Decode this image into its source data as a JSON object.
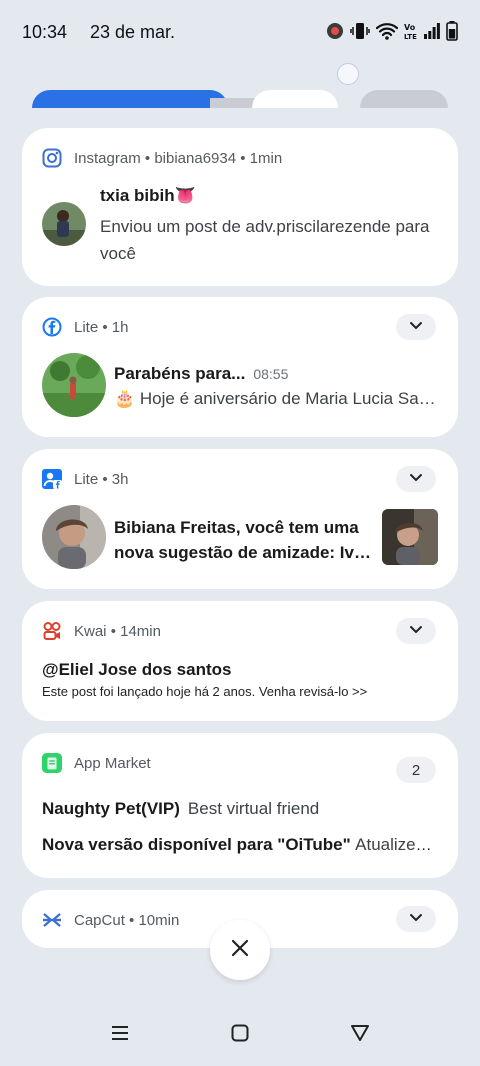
{
  "status_bar": {
    "time": "10:34",
    "date": "23 de mar."
  },
  "notifications": [
    {
      "app": "Instagram",
      "account": "bibiana6934",
      "time": "1min",
      "sep": "•",
      "title": "txia bibih👅",
      "body": "Enviou um post de adv.priscilarezende para você"
    },
    {
      "app": "Lite",
      "time": "1h",
      "sep": "•",
      "title": "Parabéns para...",
      "stamp": "08:55",
      "body": "🎂 Hoje é aniversário de Maria Lucia Santos"
    },
    {
      "app": "Lite",
      "time": "3h",
      "sep": "•",
      "body_line1": "Bibiana Freitas, você tem uma",
      "body_line2": "nova sugestão de amizade: Ivone Freitas"
    },
    {
      "app": "Kwai",
      "time": "14min",
      "sep": "•",
      "title": "@Eliel Jose dos santos",
      "body": "Este post foi lançado hoje há 2 anos. Venha revisá-lo >>"
    },
    {
      "app": "App Market",
      "count": "2",
      "line1_title": "Naughty Pet(VIP)",
      "line1_body": "Best virtual friend",
      "line2_title": "Nova versão disponível para \"OiTube\"",
      "line2_body": "Atualize agora"
    },
    {
      "app": "CapCut",
      "time": "10min",
      "sep": "•"
    }
  ],
  "colors": {
    "background": "#e4e8ef",
    "card": "#ffffff",
    "accent": "#2a71e6",
    "instagram": "#3b6fd1",
    "facebook": "#1877f2",
    "kwai": "#e0412f",
    "appmarket": "#2ed36a",
    "capcut": "#3b6fd1"
  }
}
